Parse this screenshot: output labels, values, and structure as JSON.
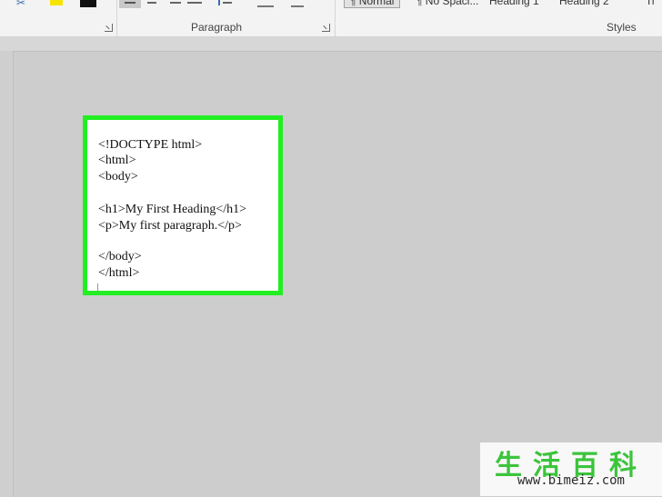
{
  "ribbon": {
    "paragraph_label": "Paragraph",
    "styles_label": "Styles",
    "styles": [
      "¶ Normal",
      "¶ No Spaci...",
      "Heading 1",
      "Heading 2",
      "Ti"
    ]
  },
  "document": {
    "code_lines": [
      "<!DOCTYPE html>",
      "<html>",
      "<body>",
      "<h1>My First Heading</h1>",
      "<p>My first paragraph.</p>",
      "</body>",
      "</html>"
    ]
  },
  "watermark": {
    "text_cn": "生活百科",
    "url": "www.bimeiz.com"
  },
  "colors": {
    "highlight_border": "#22ee22",
    "watermark_green": "#3cc43c"
  }
}
